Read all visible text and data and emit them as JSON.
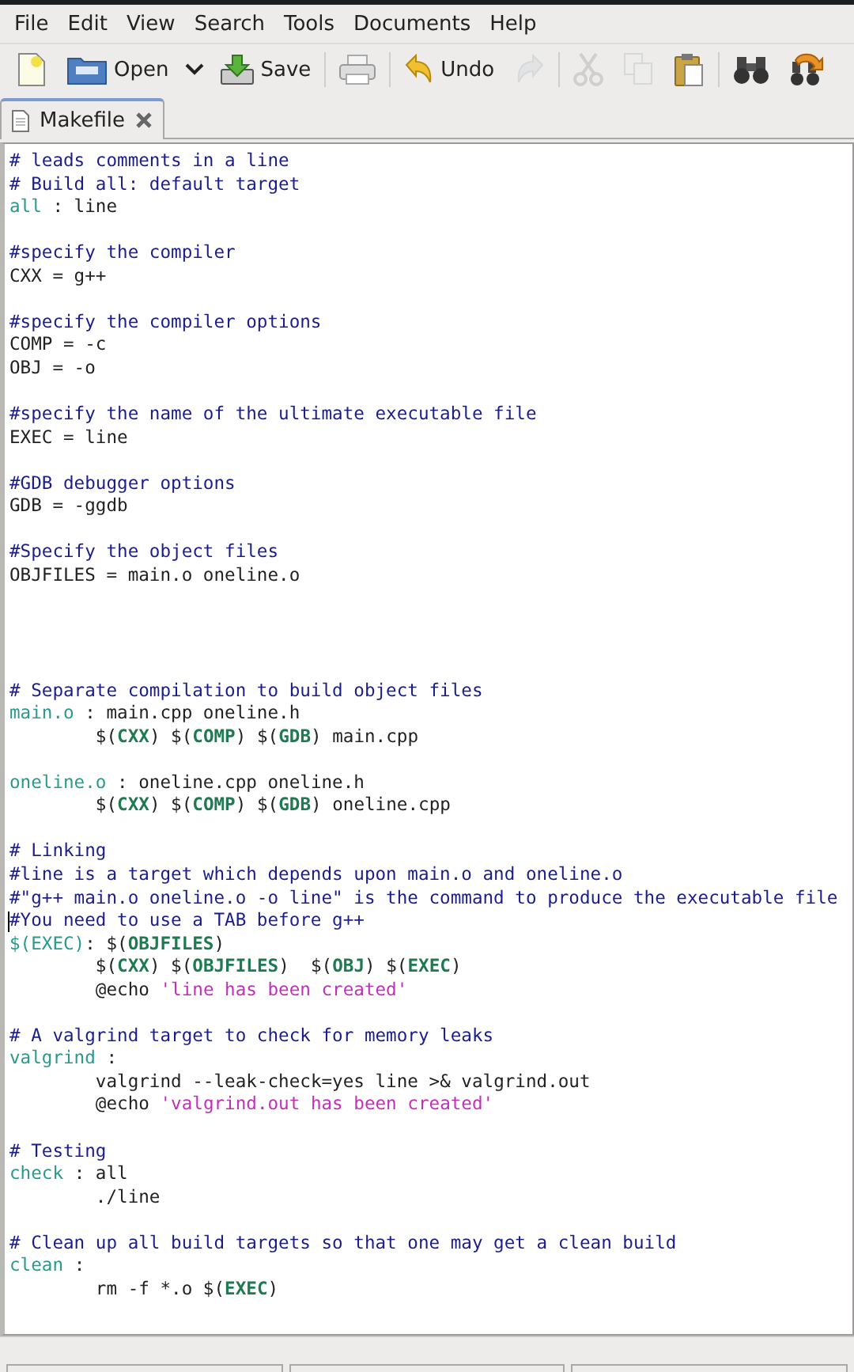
{
  "menu": [
    "File",
    "Edit",
    "View",
    "Search",
    "Tools",
    "Documents",
    "Help"
  ],
  "toolbar": [
    {
      "kind": "new",
      "disabled": false
    },
    {
      "kind": "open",
      "label": "Open",
      "disabled": false
    },
    {
      "kind": "dropdown",
      "disabled": false
    },
    {
      "kind": "save",
      "label": "Save",
      "disabled": false
    },
    {
      "kind": "separator"
    },
    {
      "kind": "print",
      "disabled": false
    },
    {
      "kind": "separator"
    },
    {
      "kind": "undo",
      "label": "Undo",
      "disabled": false
    },
    {
      "kind": "redo",
      "disabled": true
    },
    {
      "kind": "separator"
    },
    {
      "kind": "cut",
      "disabled": true
    },
    {
      "kind": "copy",
      "disabled": true
    },
    {
      "kind": "paste",
      "disabled": false
    },
    {
      "kind": "separator"
    },
    {
      "kind": "find",
      "disabled": false
    },
    {
      "kind": "replace",
      "disabled": false
    }
  ],
  "tabs": [
    {
      "label": "Makefile",
      "selected": true
    }
  ],
  "editor": {
    "lines": [
      {
        "kind": "code",
        "segments": [
          {
            "kind": "comment",
            "text": "# leads comments in a line"
          }
        ]
      },
      {
        "kind": "code",
        "segments": [
          {
            "kind": "comment",
            "text": "# Build all: default target"
          }
        ]
      },
      {
        "kind": "code",
        "segments": [
          {
            "kind": "target",
            "text": "all"
          },
          {
            "kind": "plain",
            "text": " : line"
          }
        ]
      },
      {
        "kind": "blank"
      },
      {
        "kind": "code",
        "segments": [
          {
            "kind": "comment",
            "text": "#specify the compiler"
          }
        ]
      },
      {
        "kind": "code",
        "segments": [
          {
            "kind": "plain",
            "text": "CXX = g++"
          }
        ]
      },
      {
        "kind": "blank"
      },
      {
        "kind": "code",
        "segments": [
          {
            "kind": "comment",
            "text": "#specify the compiler options"
          }
        ]
      },
      {
        "kind": "code",
        "segments": [
          {
            "kind": "plain",
            "text": "COMP = -c"
          }
        ]
      },
      {
        "kind": "code",
        "segments": [
          {
            "kind": "plain",
            "text": "OBJ = -o"
          }
        ]
      },
      {
        "kind": "blank"
      },
      {
        "kind": "code",
        "segments": [
          {
            "kind": "comment",
            "text": "#specify the name of the ultimate executable file"
          }
        ]
      },
      {
        "kind": "code",
        "segments": [
          {
            "kind": "plain",
            "text": "EXEC = line"
          }
        ]
      },
      {
        "kind": "blank"
      },
      {
        "kind": "code",
        "segments": [
          {
            "kind": "comment",
            "text": "#GDB debugger options"
          }
        ]
      },
      {
        "kind": "code",
        "segments": [
          {
            "kind": "plain",
            "text": "GDB = -ggdb"
          }
        ]
      },
      {
        "kind": "blank"
      },
      {
        "kind": "code",
        "segments": [
          {
            "kind": "comment",
            "text": "#Specify the object files"
          }
        ]
      },
      {
        "kind": "code",
        "segments": [
          {
            "kind": "plain",
            "text": "OBJFILES = main.o oneline.o"
          }
        ]
      },
      {
        "kind": "blank"
      },
      {
        "kind": "blank"
      },
      {
        "kind": "blank"
      },
      {
        "kind": "blank"
      },
      {
        "kind": "code",
        "segments": [
          {
            "kind": "comment",
            "text": "# Separate compilation to build object files"
          }
        ]
      },
      {
        "kind": "code",
        "segments": [
          {
            "kind": "target",
            "text": "main.o"
          },
          {
            "kind": "plain",
            "text": " : main.cpp oneline.h"
          }
        ]
      },
      {
        "kind": "code",
        "segments": [
          {
            "kind": "plain",
            "text": "\t$("
          },
          {
            "kind": "var",
            "text": "CXX"
          },
          {
            "kind": "plain",
            "text": ") $("
          },
          {
            "kind": "var",
            "text": "COMP"
          },
          {
            "kind": "plain",
            "text": ") $("
          },
          {
            "kind": "var",
            "text": "GDB"
          },
          {
            "kind": "plain",
            "text": ") main.cpp"
          }
        ]
      },
      {
        "kind": "blank"
      },
      {
        "kind": "code",
        "segments": [
          {
            "kind": "target",
            "text": "oneline.o"
          },
          {
            "kind": "plain",
            "text": " : oneline.cpp oneline.h"
          }
        ]
      },
      {
        "kind": "code",
        "segments": [
          {
            "kind": "plain",
            "text": "\t$("
          },
          {
            "kind": "var",
            "text": "CXX"
          },
          {
            "kind": "plain",
            "text": ") $("
          },
          {
            "kind": "var",
            "text": "COMP"
          },
          {
            "kind": "plain",
            "text": ") $("
          },
          {
            "kind": "var",
            "text": "GDB"
          },
          {
            "kind": "plain",
            "text": ") oneline.cpp"
          }
        ]
      },
      {
        "kind": "blank"
      },
      {
        "kind": "code",
        "segments": [
          {
            "kind": "comment",
            "text": "# Linking"
          }
        ]
      },
      {
        "kind": "code",
        "segments": [
          {
            "kind": "comment",
            "text": "#line is a target which depends upon main.o and oneline.o"
          }
        ]
      },
      {
        "kind": "code",
        "segments": [
          {
            "kind": "comment",
            "text": "#\"g++ main.o oneline.o -o line\" is the command to produce the executable file"
          }
        ]
      },
      {
        "kind": "code",
        "cursor": true,
        "segments": [
          {
            "kind": "comment",
            "text": "#You need to use a TAB before g++"
          }
        ]
      },
      {
        "kind": "code",
        "segments": [
          {
            "kind": "target",
            "text": "$(EXEC)"
          },
          {
            "kind": "plain",
            "text": ": $("
          },
          {
            "kind": "var",
            "text": "OBJFILES"
          },
          {
            "kind": "plain",
            "text": ")"
          }
        ]
      },
      {
        "kind": "code",
        "segments": [
          {
            "kind": "plain",
            "text": "\t$("
          },
          {
            "kind": "var",
            "text": "CXX"
          },
          {
            "kind": "plain",
            "text": ") $("
          },
          {
            "kind": "var",
            "text": "OBJFILES"
          },
          {
            "kind": "plain",
            "text": ")  $("
          },
          {
            "kind": "var",
            "text": "OBJ"
          },
          {
            "kind": "plain",
            "text": ") $("
          },
          {
            "kind": "var",
            "text": "EXEC"
          },
          {
            "kind": "plain",
            "text": ")"
          }
        ]
      },
      {
        "kind": "code",
        "segments": [
          {
            "kind": "plain",
            "text": "\t@echo "
          },
          {
            "kind": "string",
            "text": "'line has been created'"
          }
        ]
      },
      {
        "kind": "blank"
      },
      {
        "kind": "code",
        "segments": [
          {
            "kind": "comment",
            "text": "# A valgrind target to check for memory leaks"
          }
        ]
      },
      {
        "kind": "code",
        "segments": [
          {
            "kind": "target",
            "text": "valgrind"
          },
          {
            "kind": "plain",
            "text": " :"
          }
        ]
      },
      {
        "kind": "code",
        "segments": [
          {
            "kind": "plain",
            "text": "\tvalgrind --leak-check=yes line >& valgrind.out"
          }
        ]
      },
      {
        "kind": "code",
        "segments": [
          {
            "kind": "plain",
            "text": "\t@echo "
          },
          {
            "kind": "string",
            "text": "'valgrind.out has been created'"
          }
        ]
      },
      {
        "kind": "blank"
      },
      {
        "kind": "code",
        "segments": [
          {
            "kind": "comment",
            "text": "# Testing"
          }
        ]
      },
      {
        "kind": "code",
        "segments": [
          {
            "kind": "target",
            "text": "check"
          },
          {
            "kind": "plain",
            "text": " : all"
          }
        ]
      },
      {
        "kind": "code",
        "segments": [
          {
            "kind": "plain",
            "text": "\t./line"
          }
        ]
      },
      {
        "kind": "blank"
      },
      {
        "kind": "code",
        "segments": [
          {
            "kind": "comment",
            "text": "# Clean up all build targets so that one may get a clean build"
          }
        ]
      },
      {
        "kind": "code",
        "segments": [
          {
            "kind": "target",
            "text": "clean"
          },
          {
            "kind": "plain",
            "text": " :"
          }
        ]
      },
      {
        "kind": "code",
        "segments": [
          {
            "kind": "plain",
            "text": "\trm -f *.o $("
          },
          {
            "kind": "var",
            "text": "EXEC"
          },
          {
            "kind": "plain",
            "text": ")"
          }
        ]
      }
    ]
  }
}
